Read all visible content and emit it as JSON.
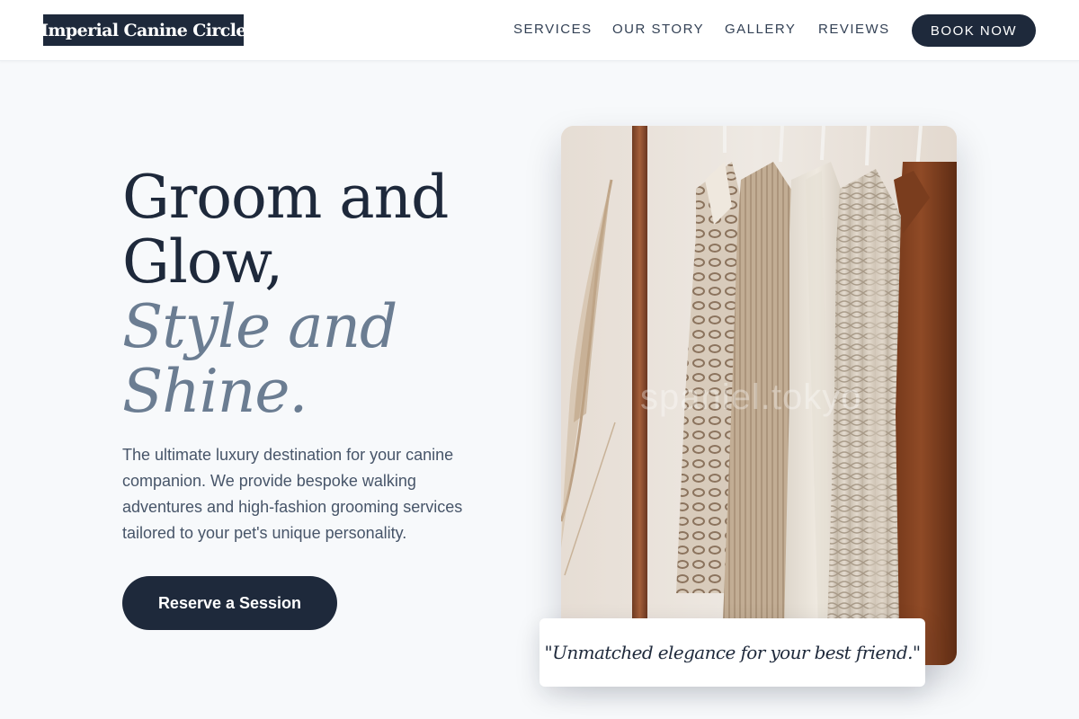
{
  "brand": {
    "name": "Imperial Canine Circle"
  },
  "nav": {
    "items": [
      {
        "label": "SERVICES"
      },
      {
        "label": "OUR STORY"
      },
      {
        "label": "GALLERY"
      },
      {
        "label": "REVIEWS"
      }
    ],
    "cta_label": "BOOK NOW"
  },
  "hero": {
    "title_line1": "Groom and",
    "title_line2": "Glow,",
    "title_line3": "Style and",
    "title_line4": "Shine.",
    "description": "The ultimate luxury destination for your canine companion. We provide bespoke walking adventures and high-fashion grooming services tailored to your pet's unique personality.",
    "cta_label": "Reserve a Session"
  },
  "image": {
    "watermark": "spaniel.tokyo",
    "quote": "\"Unmatched elegance for your best friend.\""
  },
  "colors": {
    "navy": "#1e293b",
    "slate_accent": "#6b7d92",
    "background": "#f7f9fb"
  }
}
